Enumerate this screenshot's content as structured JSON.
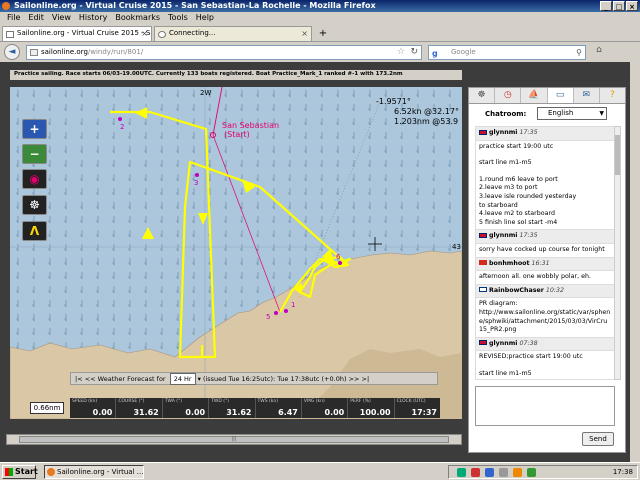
{
  "window": {
    "title": "Sailonline.org - Virtual Cruise 2015 - San Sebastian-La Rochelle - Mozilla Firefox"
  },
  "menu": [
    "File",
    "Edit",
    "View",
    "History",
    "Bookmarks",
    "Tools",
    "Help"
  ],
  "tabs": [
    {
      "label": "Sailonline.org - Virtual Cruise 2015 - San S..."
    },
    {
      "label": "Connecting..."
    }
  ],
  "nav": {
    "url_host": "sailonline.org",
    "url_path": "/windy/run/801/",
    "search_placeholder": "Google"
  },
  "race": {
    "header": "Practice sailing. Race starts 06/03-19.00UTC. Currently 133 boats registered. Boat Practice_Mark_1 ranked #-1 with 173.2nm"
  },
  "map": {
    "longitude_label": "2W",
    "heading_label": "-1.9571°",
    "readout_1": "6.52kn @32.17°",
    "readout_2": "1.203nm @53.9",
    "edge_label": "43",
    "start_label": "San Sebastian",
    "start_sub": "(Start)",
    "marks": [
      "1",
      "2",
      "3",
      "5",
      "6"
    ],
    "scale": "0.66nm",
    "colors": {
      "sea": "#acc6dc",
      "land": "#d9c7a6",
      "course": "#ffff00",
      "track": "#e0006e"
    }
  },
  "forecast": {
    "prefix": "|< << Weather Forecast for",
    "period": "24 Hr",
    "issued": "(issued Tue 16:25utc): Tue 17:38utc (+0.0h)",
    "suffix": ">> >|"
  },
  "instruments": [
    {
      "label": "SPEED (kn)",
      "value": "0.00"
    },
    {
      "label": "COURSE (°)",
      "value": "31.62"
    },
    {
      "label": "TWA (°)",
      "value": "0.00"
    },
    {
      "label": "TWD (°)",
      "value": "31.62"
    },
    {
      "label": "TWS (kn)",
      "value": "6.47"
    },
    {
      "label": "VMG (kn)",
      "value": "0.00"
    },
    {
      "label": "PERF (%)",
      "value": "100.00"
    },
    {
      "label": "CLOCK (UTC)",
      "value": "17:37"
    }
  ],
  "chat": {
    "room_label": "Chatroom:",
    "room": "English",
    "send": "Send",
    "messages": [
      {
        "user": "glynnmi",
        "time": "17:35",
        "flag": "gb",
        "lines": [
          "practice start 19:00 utc",
          "",
          "start line m1-m5",
          "",
          "1.round m6 leave to port",
          "2.leave m3 to port",
          "3.leave isle rounded yesterday",
          " to starboard",
          "4.leave m2 to starboard",
          "5 finish line sol start -m4"
        ]
      },
      {
        "user": "glynnmi",
        "time": "17:35",
        "flag": "gb",
        "lines": [
          "sorry have cocked up course for tonight"
        ]
      },
      {
        "user": "bonhmhoot",
        "time": "16:31",
        "flag": "ch",
        "lines": [
          "afternoon all. one wobbly polar, eh."
        ]
      },
      {
        "user": "RainbowChaser",
        "time": "10:32",
        "flag": "fi",
        "lines": [
          "PR diagram:",
          "http://www.sailonline.org/static/var/sphene/sphwiki/attachment/2015/03/03/VirCru15_PR2.png"
        ]
      },
      {
        "user": "glynnmi",
        "time": "07:38",
        "flag": "gb",
        "lines": [
          "REVISED;practice start 19:00 utc",
          "",
          "start line m1-m5"
        ]
      }
    ]
  },
  "taskbar": {
    "start": "Start",
    "task": "Sailonline.org - Virtual ...",
    "clock": "17:38"
  }
}
